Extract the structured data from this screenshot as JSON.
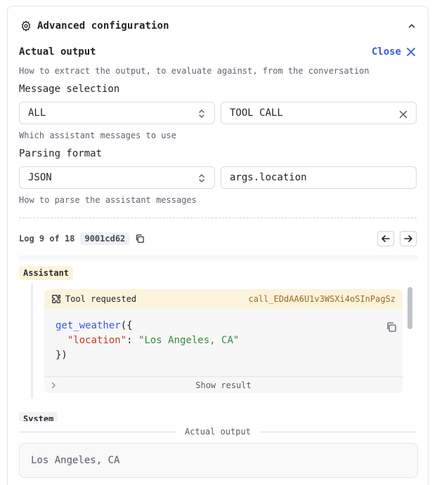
{
  "header": {
    "title": "Advanced configuration",
    "icon": "gear-icon",
    "collapse_icon": "chevron-up-icon"
  },
  "actual_output_section": {
    "title": "Actual output",
    "close_label": "Close",
    "description": "How to extract the output, to evaluate against, from the conversation"
  },
  "message_selection": {
    "label": "Message selection",
    "select_value": "ALL",
    "filter_value": "TOOL CALL",
    "help": "Which assistant messages to use"
  },
  "parsing_format": {
    "label": "Parsing format",
    "select_value": "JSON",
    "path_value": "args.location",
    "help": "How to parse the assistant messages"
  },
  "log_nav": {
    "text": "Log 9 of 18",
    "hash": "9001cd62"
  },
  "transcript": {
    "assistant_role": "Assistant",
    "tool_card": {
      "title": "Tool requested",
      "call_id": "call_EDdAA6U1v3WSXi4oSInPagSz",
      "fn_name": "get_weather",
      "open": "({",
      "key": "\"location\"",
      "colon": ": ",
      "value": "\"Los Angeles, CA\"",
      "close": "})",
      "show_result_label": "Show result"
    },
    "system_role": "System"
  },
  "actual_output": {
    "divider_label": "Actual output",
    "value": "Los Angeles, CA"
  },
  "colors": {
    "accent": "#3b5bdb",
    "assistant_badge": "#fdf3d8",
    "tool_header": "#fcf3dc"
  }
}
